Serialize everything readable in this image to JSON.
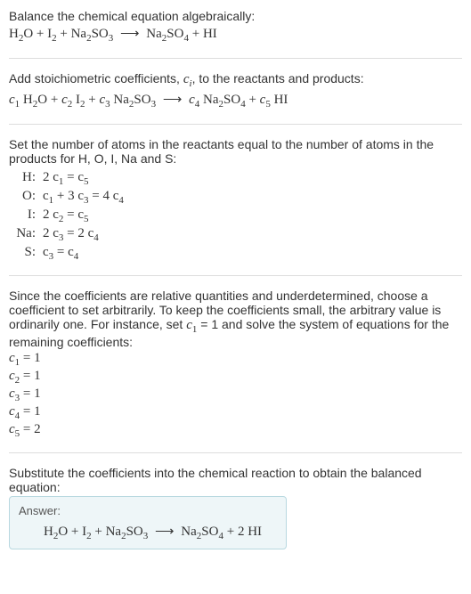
{
  "section1": {
    "intro": "Balance the chemical equation algebraically:",
    "eq_lhs1": "H",
    "eq_lhs1s": "2",
    "eq_lhs2": "O + I",
    "eq_lhs2s": "2",
    "eq_lhs3": " + Na",
    "eq_lhs3s": "2",
    "eq_lhs4": "SO",
    "eq_lhs4s": "3",
    "arrow": "⟶",
    "eq_rhs1": "Na",
    "eq_rhs1s": "2",
    "eq_rhs2": "SO",
    "eq_rhs2s": "4",
    "eq_rhs3": " + HI"
  },
  "section2": {
    "intro1": "Add stoichiometric coefficients, ",
    "ci": "c",
    "ci_sub": "i",
    "intro2": ", to the reactants and products:",
    "c1": "c",
    "c1s": "1",
    "sp1": " H",
    "sp1s": "2",
    "sp1b": "O + ",
    "c2": "c",
    "c2s": "2",
    "sp2": " I",
    "sp2s": "2",
    "sp2b": " + ",
    "c3": "c",
    "c3s": "3",
    "sp3": " Na",
    "sp3s": "2",
    "sp3b": "SO",
    "sp3bs": "3",
    "arrow": "⟶",
    "c4": "c",
    "c4s": "4",
    "sp4": " Na",
    "sp4s": "2",
    "sp4b": "SO",
    "sp4bs": "4",
    "sp4c": " + ",
    "c5": "c",
    "c5s": "5",
    "sp5": " HI"
  },
  "section3": {
    "intro": "Set the number of atoms in the reactants equal to the number of atoms in the products for H, O, I, Na and S:",
    "rows": [
      {
        "el": "H:",
        "lhs": "2 c",
        "ls": "1",
        "mid": " = c",
        "rs": "5"
      },
      {
        "el": "O:",
        "lhs": "c",
        "ls": "1",
        "mid": " + 3 c",
        "ms": "3",
        "mid2": " = 4 c",
        "rs": "4"
      },
      {
        "el": "I:",
        "lhs": "2 c",
        "ls": "2",
        "mid": " = c",
        "rs": "5"
      },
      {
        "el": "Na:",
        "lhs": "2 c",
        "ls": "3",
        "mid": " = 2 c",
        "rs": "4"
      },
      {
        "el": "S:",
        "lhs": "c",
        "ls": "3",
        "mid": " = c",
        "rs": "4"
      }
    ]
  },
  "section4": {
    "text1": "Since the coefficients are relative quantities and underdetermined, choose a coefficient to set arbitrarily. To keep the coefficients small, the arbitrary value is ordinarily one. For instance, set ",
    "c1": "c",
    "c1s": "1",
    "text2": " = 1 and solve the system of equations for the remaining coefficients:",
    "coeffs": [
      {
        "c": "c",
        "s": "1",
        "v": " = 1"
      },
      {
        "c": "c",
        "s": "2",
        "v": " = 1"
      },
      {
        "c": "c",
        "s": "3",
        "v": " = 1"
      },
      {
        "c": "c",
        "s": "4",
        "v": " = 1"
      },
      {
        "c": "c",
        "s": "5",
        "v": " = 2"
      }
    ]
  },
  "section5": {
    "intro": "Substitute the coefficients into the chemical reaction to obtain the balanced equation:",
    "answer_label": "Answer:",
    "lhs1": "H",
    "lhs1s": "2",
    "lhs2": "O + I",
    "lhs2s": "2",
    "lhs3": " + Na",
    "lhs3s": "2",
    "lhs4": "SO",
    "lhs4s": "3",
    "arrow": "⟶",
    "rhs1": "Na",
    "rhs1s": "2",
    "rhs2": "SO",
    "rhs2s": "4",
    "rhs3": " + 2 HI"
  }
}
